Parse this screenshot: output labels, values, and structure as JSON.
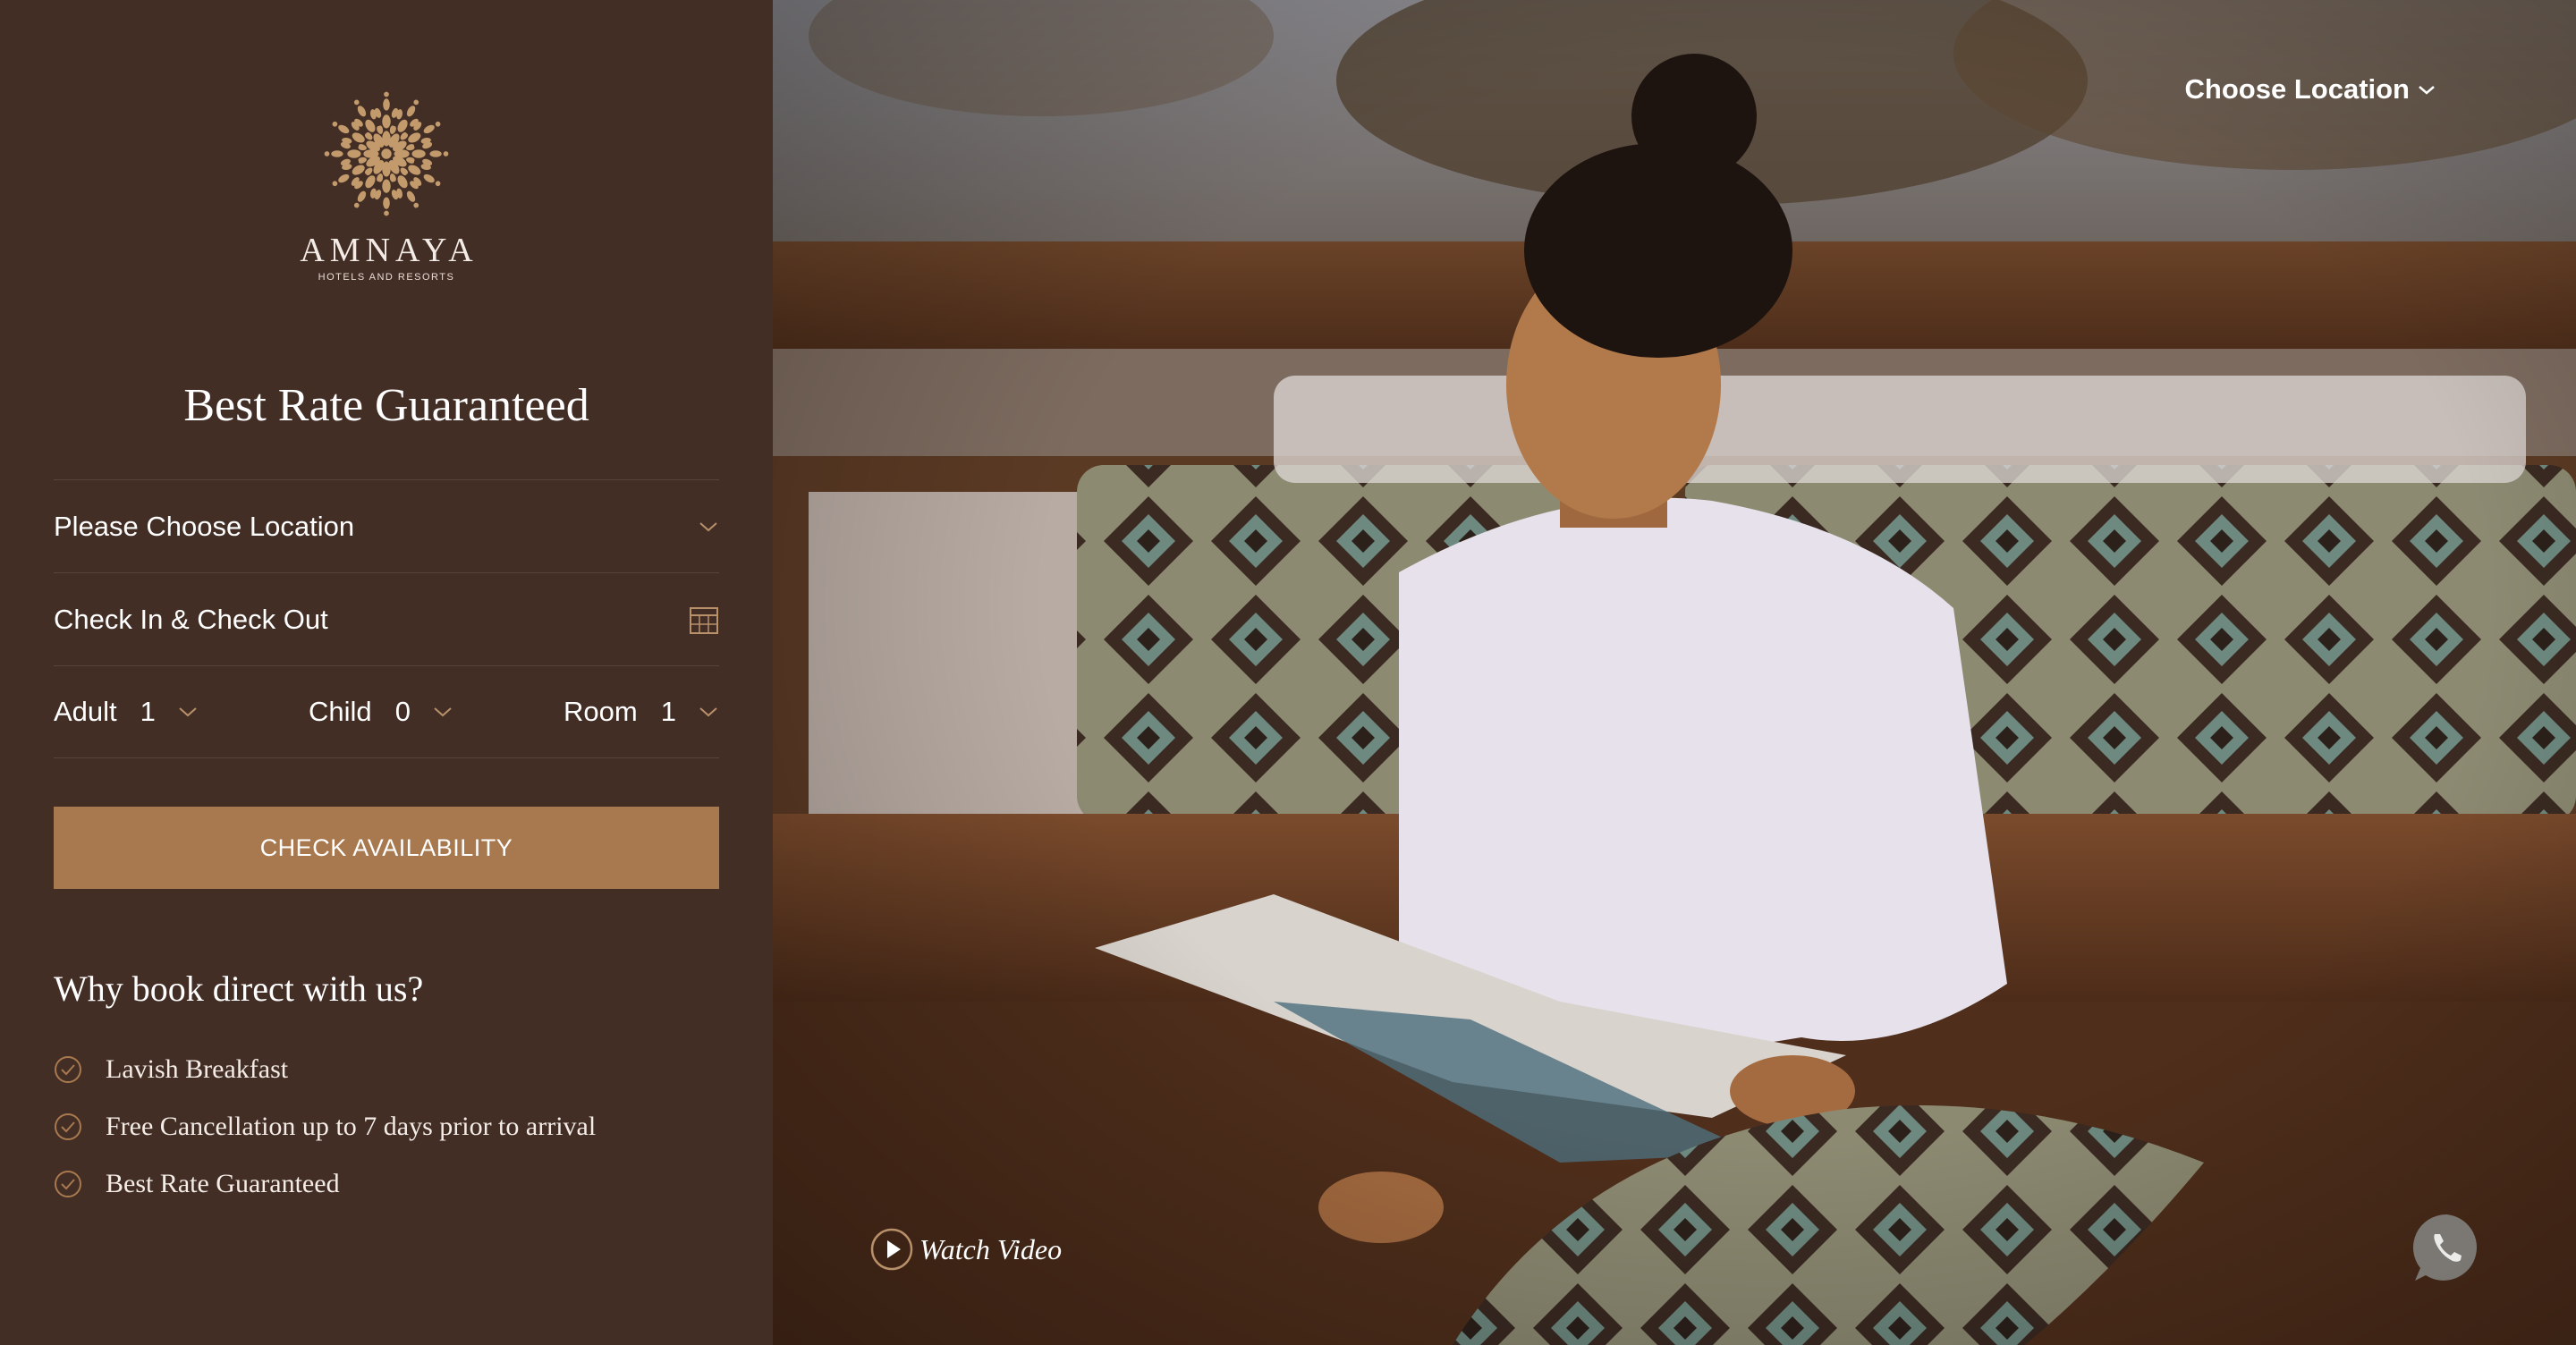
{
  "brand": {
    "name": "AMNAYA",
    "tagline": "HOTELS AND RESORTS",
    "accent_color": "#a8794f",
    "panel_color": "#432e26"
  },
  "booking": {
    "headline": "Best Rate Guaranteed",
    "location_placeholder": "Please Choose Location",
    "dates_label": "Check In & Check Out",
    "adult_label": "Adult",
    "adult_value": "1",
    "child_label": "Child",
    "child_value": "0",
    "room_label": "Room",
    "room_value": "1",
    "submit_label": "CHECK AVAILABILITY"
  },
  "why": {
    "title": "Why book direct with us?",
    "items": [
      "Lavish Breakfast",
      "Free Cancellation up to 7 days prior to arrival",
      "Best Rate Guaranteed"
    ]
  },
  "hero": {
    "choose_location": "Choose Location",
    "watch_video": "Watch Video"
  },
  "icons": {
    "logo": "mandala-logo-icon",
    "dropdown": "chevron-down-icon",
    "calendar": "calendar-icon",
    "benefit": "check-circle-icon",
    "play": "play-circle-icon",
    "chat": "whatsapp-icon"
  }
}
